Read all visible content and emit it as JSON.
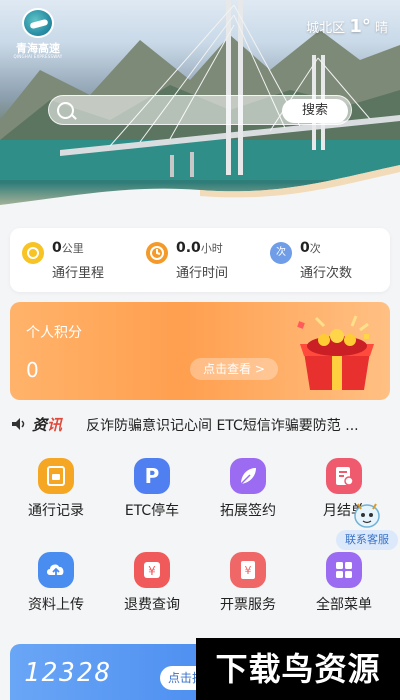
{
  "header": {
    "logo_text": "青海高速",
    "logo_subtext": "QINGHAI EXPRESSWAY",
    "location": "城北区",
    "temperature": "1°",
    "weather_word": "晴",
    "search_button": "搜索"
  },
  "stats": [
    {
      "value": "0",
      "unit": "公里",
      "label": "通行里程",
      "icon": "road-coin-icon",
      "color": "#f7c325"
    },
    {
      "value": "0.0",
      "unit": "小时",
      "label": "通行时间",
      "icon": "clock-icon",
      "color": "#f39a2a"
    },
    {
      "value": "0",
      "unit": "次",
      "label": "通行次数",
      "icon": "count-icon",
      "color": "#6f9de8",
      "icon_text": "次"
    }
  ],
  "points": {
    "title": "个人积分",
    "value": "0",
    "button": "点击查看 >"
  },
  "news": {
    "tag_black": "资",
    "tag_red": "讯",
    "text": "反诈防骗意识记心间 ETC短信诈骗要防范 ..."
  },
  "menu": [
    {
      "label": "通行记录",
      "icon": "travel-record-icon",
      "color": "#f5a623"
    },
    {
      "label": "ETC停车",
      "icon": "parking-icon",
      "color": "#4f7ff0",
      "glyph": "P"
    },
    {
      "label": "拓展签约",
      "icon": "feather-sign-icon",
      "color": "#9b6cf2"
    },
    {
      "label": "月结单",
      "icon": "monthly-bill-icon",
      "color": "#f05a6e"
    },
    {
      "label": "资料上传",
      "icon": "upload-icon",
      "color": "#4a8df0"
    },
    {
      "label": "退费查询",
      "icon": "refund-icon",
      "color": "#f05a5a",
      "glyph": "¥"
    },
    {
      "label": "开票服务",
      "icon": "invoice-icon",
      "color": "#f06767",
      "glyph": "¥"
    },
    {
      "label": "全部菜单",
      "icon": "all-menu-icon",
      "color": "#9b6cf2"
    }
  ],
  "service": {
    "label": "联系客服"
  },
  "hotline": {
    "number": "12328",
    "button": "点击拨打"
  },
  "watermark": "下载鸟资源"
}
